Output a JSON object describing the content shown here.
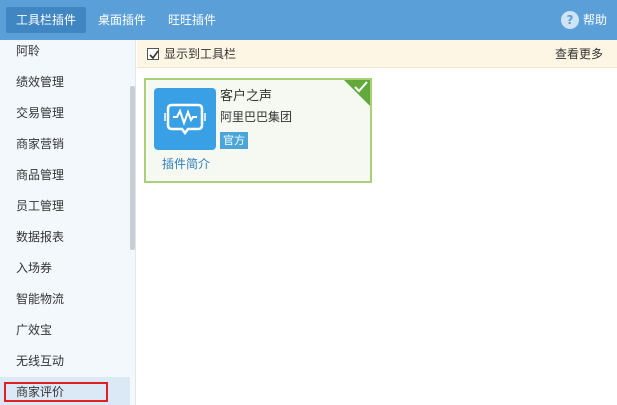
{
  "topbar": {
    "tabs": [
      {
        "label": "工具栏插件",
        "active": true
      },
      {
        "label": "桌面插件",
        "active": false
      },
      {
        "label": "旺旺插件",
        "active": false
      }
    ],
    "help_label": "帮助",
    "help_icon": "help-circle-icon"
  },
  "sidebar": {
    "items": [
      {
        "label": "阿聆"
      },
      {
        "label": "绩效管理"
      },
      {
        "label": "交易管理"
      },
      {
        "label": "商家营销"
      },
      {
        "label": "商品管理"
      },
      {
        "label": "员工管理"
      },
      {
        "label": "数据报表"
      },
      {
        "label": "入场券"
      },
      {
        "label": "智能物流"
      },
      {
        "label": "广效宝"
      },
      {
        "label": "无线互动"
      },
      {
        "label": "商家评价"
      }
    ],
    "selected_index": 11
  },
  "content": {
    "show_in_toolbar": {
      "label": "显示到工具栏",
      "checked": true
    },
    "see_more": "查看更多"
  },
  "plugin": {
    "title": "客户之声",
    "org": "阿里巴巴集团",
    "badge": "官方",
    "intro_link": "插件简介",
    "installed": true,
    "icon": "voice-wave-icon"
  },
  "colors": {
    "topbar": "#5a9fd8",
    "active_tab": "#3f86c2",
    "card_border": "#a9cf78",
    "check_corner": "#62a93c",
    "app_icon": "#3aa0e6",
    "badge": "#4aa6d9",
    "highlight_box": "#e02020"
  }
}
